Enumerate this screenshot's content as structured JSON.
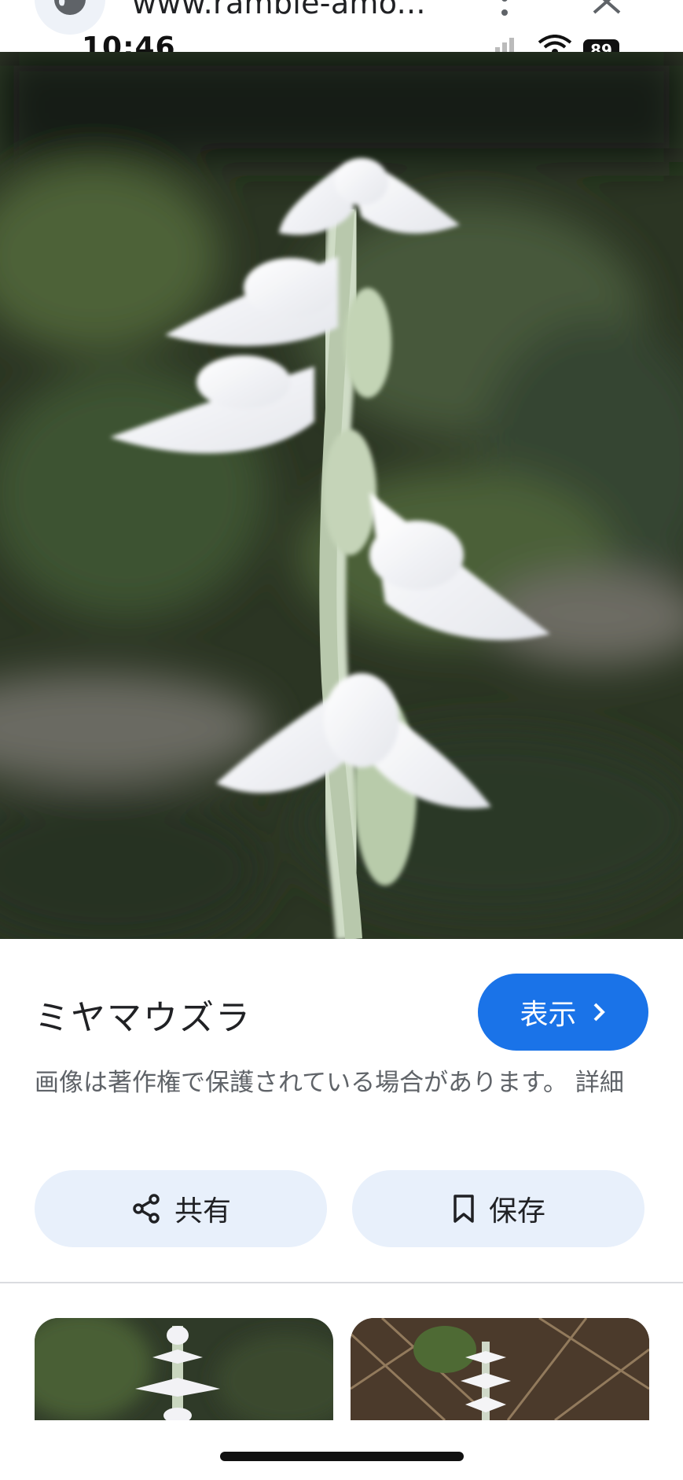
{
  "browser": {
    "url": "www.ramble-amo...",
    "time": "10:46",
    "battery": "89"
  },
  "icons": {
    "site": "globe-icon",
    "menu": "more-vert-icon",
    "close": "close-icon",
    "signal": "signal-icon",
    "wifi": "wifi-icon",
    "share": "share-icon",
    "save": "bookmark-icon",
    "view": "chevron-right-icon"
  },
  "image": {
    "title": "ミヤマウズラ",
    "view_label": "表示",
    "copyright_notice": "画像は著作権で保護されている場合があります。",
    "details_link": "詳細"
  },
  "actions": {
    "share_label": "共有",
    "save_label": "保存"
  },
  "colors": {
    "accent": "#1a73e8",
    "pill_background": "#e8f0fb"
  }
}
